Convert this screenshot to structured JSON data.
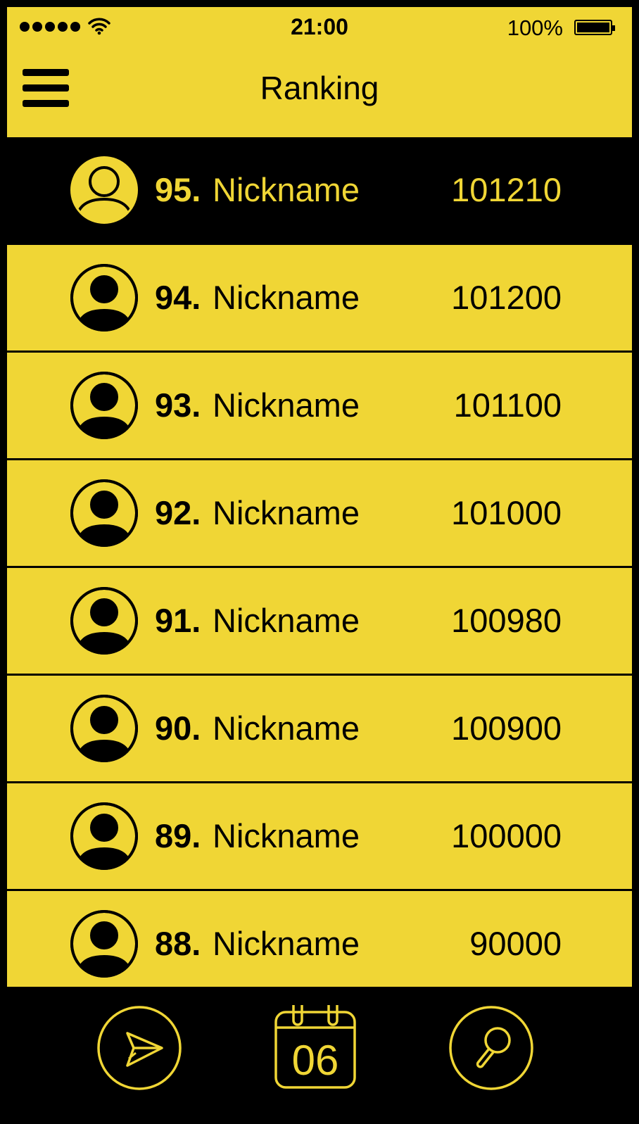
{
  "status_bar": {
    "time": "21:00",
    "battery_percent": "100%",
    "signal_icon": "signal-dots-icon",
    "wifi_icon": "wifi-icon",
    "battery_icon": "battery-icon"
  },
  "header": {
    "title": "Ranking",
    "menu_icon": "hamburger-menu-icon"
  },
  "ranking": {
    "items": [
      {
        "rank": "95.",
        "nickname": "Nickname",
        "score": "101210",
        "current_user": true
      },
      {
        "rank": "94.",
        "nickname": "Nickname",
        "score": "101200"
      },
      {
        "rank": "93.",
        "nickname": "Nickname",
        "score": "101100"
      },
      {
        "rank": "92.",
        "nickname": "Nickname",
        "score": "101000"
      },
      {
        "rank": "91.",
        "nickname": "Nickname",
        "score": "100980"
      },
      {
        "rank": "90.",
        "nickname": "Nickname",
        "score": "100900"
      },
      {
        "rank": "89.",
        "nickname": "Nickname",
        "score": "100000"
      },
      {
        "rank": "88.",
        "nickname": "Nickname",
        "score": "90000"
      }
    ]
  },
  "bottom_nav": {
    "send_icon": "send-icon",
    "calendar_icon": "calendar-icon",
    "calendar_day": "06",
    "search_icon": "search-icon"
  },
  "colors": {
    "accent": "#F0D635",
    "dark": "#000000"
  }
}
